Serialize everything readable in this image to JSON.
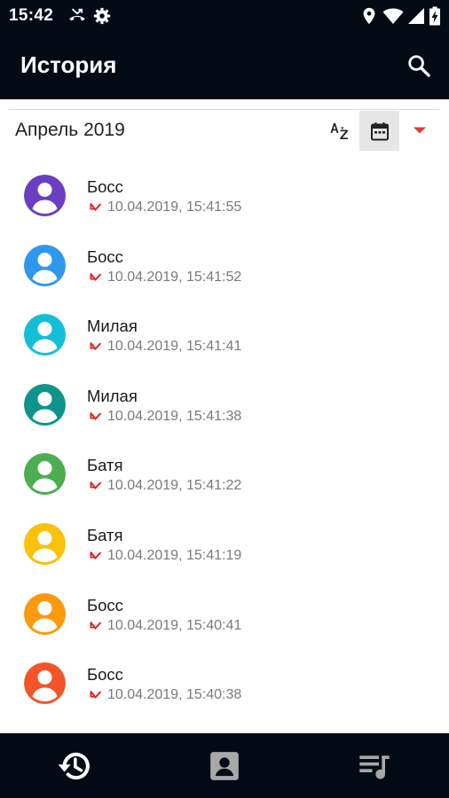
{
  "status_bar": {
    "time": "15:42",
    "icons": [
      "missed-call-icon",
      "settings-gear-icon",
      "location-pin-icon",
      "wifi-icon",
      "cell-signal-icon",
      "battery-charging-icon"
    ]
  },
  "app_bar": {
    "title": "История",
    "search_icon": "search-icon"
  },
  "filter": {
    "month": "Апрель 2019",
    "sort_icon": "sort-az-icon",
    "calendar_icon": "calendar-icon",
    "dropdown_icon": "dropdown-arrow-icon",
    "calendar_selected": true
  },
  "calls": [
    {
      "name": "Босс",
      "time": "10.04.2019, 15:41:55",
      "avatar_color": "#6a3fc1",
      "type": "missed"
    },
    {
      "name": "Босс",
      "time": "10.04.2019, 15:41:52",
      "avatar_color": "#2f98ec",
      "type": "missed"
    },
    {
      "name": "Милая",
      "time": "10.04.2019, 15:41:41",
      "avatar_color": "#14bfd6",
      "type": "missed"
    },
    {
      "name": "Милая",
      "time": "10.04.2019, 15:41:38",
      "avatar_color": "#0e948a",
      "type": "missed"
    },
    {
      "name": "Батя",
      "time": "10.04.2019, 15:41:22",
      "avatar_color": "#4cae50",
      "type": "missed"
    },
    {
      "name": "Батя",
      "time": "10.04.2019, 15:41:19",
      "avatar_color": "#f9c10a",
      "type": "missed"
    },
    {
      "name": "Босс",
      "time": "10.04.2019, 15:40:41",
      "avatar_color": "#fb9a0d",
      "type": "missed"
    },
    {
      "name": "Босс",
      "time": "10.04.2019, 15:40:38",
      "avatar_color": "#f55428",
      "type": "missed"
    }
  ],
  "bottom_nav": {
    "tabs": [
      {
        "icon": "history-icon",
        "active": true
      },
      {
        "icon": "contacts-icon",
        "active": false
      },
      {
        "icon": "playlist-icon",
        "active": false
      }
    ]
  },
  "colors": {
    "bar_background": "#040b14",
    "missed_call": "#e0231b",
    "dropdown_accent": "#e23b2e",
    "active_tab": "#ffffff",
    "inactive_tab": "#a8a8a8"
  }
}
